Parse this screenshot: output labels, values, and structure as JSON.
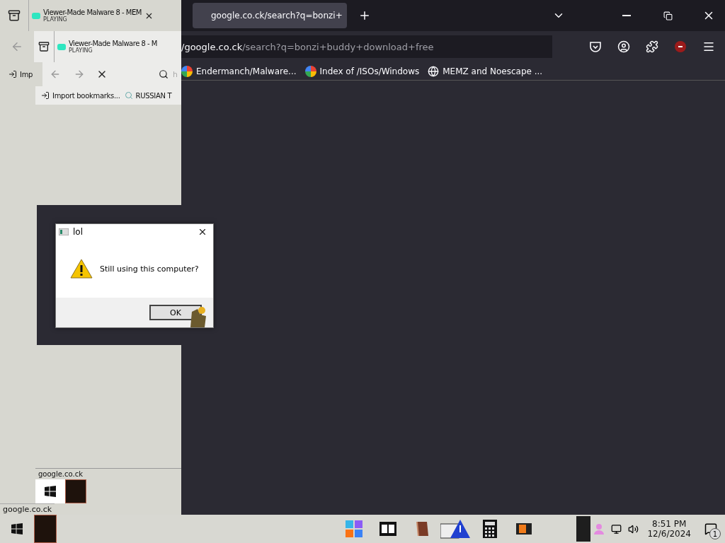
{
  "ghost_browser": {
    "tab": {
      "title": "Viewer-Made Malware 8 - MEM",
      "status": "PLAYING"
    },
    "inner_tab": {
      "title": "Viewer-Made Malware 8 - M",
      "status": "PLAYING"
    },
    "bookmark": "Imp",
    "inner_search": "h",
    "inner_bookmarks": [
      {
        "label": "Import bookmarks...",
        "kind": "import"
      },
      {
        "label": "RUSSIAN T",
        "kind": "search"
      }
    ],
    "status_texts": [
      "google.co.ck",
      "google.co.ck"
    ]
  },
  "browser": {
    "tabs": [
      {
        "title": "google.co.ck/search?q=bonzi+",
        "selected": true
      }
    ],
    "url": {
      "host": "/google.co.ck",
      "path": "/search?q=bonzi+buddy+download+free"
    },
    "bookmarks": [
      {
        "label": "Endermanch/Malware...",
        "kind": "google"
      },
      {
        "label": "Index of /ISOs/Windows",
        "kind": "google"
      },
      {
        "label": "MEMZ and Noescape ...",
        "kind": "globe"
      }
    ]
  },
  "dialog": {
    "title": "lol",
    "message": "Still using this computer?",
    "buttons": [
      "OK"
    ]
  },
  "taskbar": {
    "apps": [
      {
        "kind": "start"
      },
      {
        "kind": "archiver"
      },
      {
        "kind": "book"
      },
      {
        "kind": "warning"
      },
      {
        "kind": "calculator"
      },
      {
        "kind": "media"
      }
    ],
    "time": "8:51 PM",
    "date": "12/6/2024",
    "notifications": "1"
  }
}
